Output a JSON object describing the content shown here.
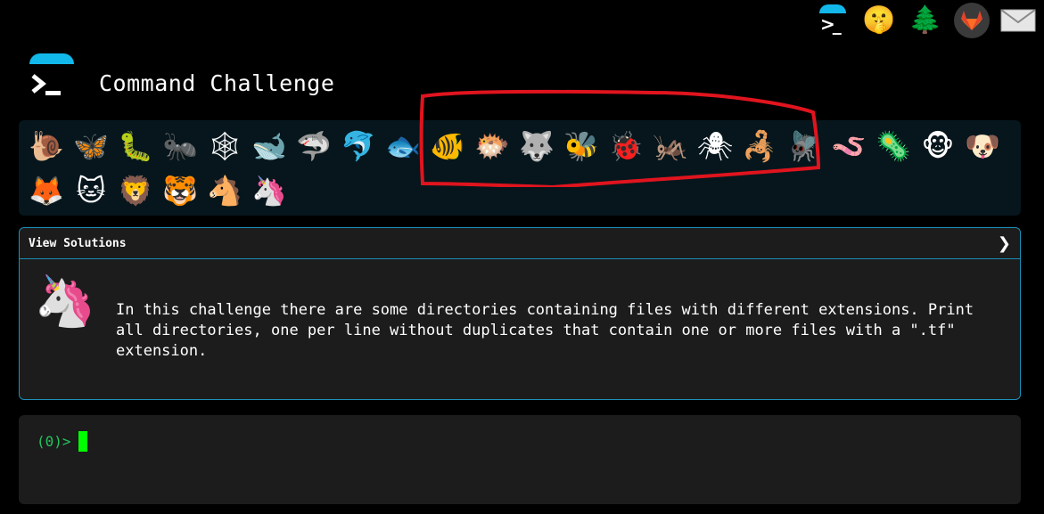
{
  "app": {
    "title": "Command Challenge"
  },
  "topnav": [
    {
      "name": "terminal-icon",
      "glyph": ""
    },
    {
      "name": "shushing-face-icon",
      "glyph": "🤫"
    },
    {
      "name": "tree-icon",
      "glyph": "🌲"
    },
    {
      "name": "gitlab-icon",
      "glyph": ""
    },
    {
      "name": "envelope-icon",
      "glyph": "✉"
    }
  ],
  "animals": [
    {
      "name": "snail",
      "glyph": "🐌"
    },
    {
      "name": "butterfly",
      "glyph": "🦋"
    },
    {
      "name": "caterpillar",
      "glyph": "🐛"
    },
    {
      "name": "ant",
      "glyph": "🐜"
    },
    {
      "name": "spider-web",
      "glyph": "🕸"
    },
    {
      "name": "whale",
      "glyph": "🐋"
    },
    {
      "name": "shark",
      "glyph": "🦈"
    },
    {
      "name": "dolphin",
      "glyph": "🐬"
    },
    {
      "name": "fish",
      "glyph": "🐟"
    },
    {
      "name": "tropical-fish",
      "glyph": "🐠"
    },
    {
      "name": "pufferfish",
      "glyph": "🐡"
    },
    {
      "name": "wolf",
      "glyph": "🐺"
    },
    {
      "name": "bee",
      "glyph": "🐝"
    },
    {
      "name": "ladybug",
      "glyph": "🐞"
    },
    {
      "name": "cricket",
      "glyph": "🦗"
    },
    {
      "name": "spider",
      "glyph": "🕷"
    },
    {
      "name": "scorpion",
      "glyph": "🦂"
    },
    {
      "name": "fly",
      "glyph": "🪰"
    },
    {
      "name": "worm",
      "glyph": "🪱"
    },
    {
      "name": "microbe",
      "glyph": "🦠"
    },
    {
      "name": "monkey",
      "glyph": "🐵"
    },
    {
      "name": "dog",
      "glyph": "🐶"
    },
    {
      "name": "fox",
      "glyph": "🦊"
    },
    {
      "name": "cat",
      "glyph": "🐱"
    },
    {
      "name": "lion",
      "glyph": "🦁"
    },
    {
      "name": "tiger",
      "glyph": "🐯"
    },
    {
      "name": "horse",
      "glyph": "🐴"
    },
    {
      "name": "unicorn",
      "glyph": "🦄"
    }
  ],
  "solutions": {
    "header": "View Solutions",
    "chevron": "❯",
    "challenge_icon": "🦄",
    "description": "In this challenge there are some directories containing files with different extensions. Print all directories, one per line without duplicates that contain one or more files with a \".tf\" extension."
  },
  "terminal": {
    "prompt": "(0)>"
  },
  "colors": {
    "accent": "#12b8ea",
    "prompt": "#22c55e",
    "cursor": "#00ff00",
    "highlight": "#e0141e",
    "panel_border": "#1d8fb8"
  }
}
